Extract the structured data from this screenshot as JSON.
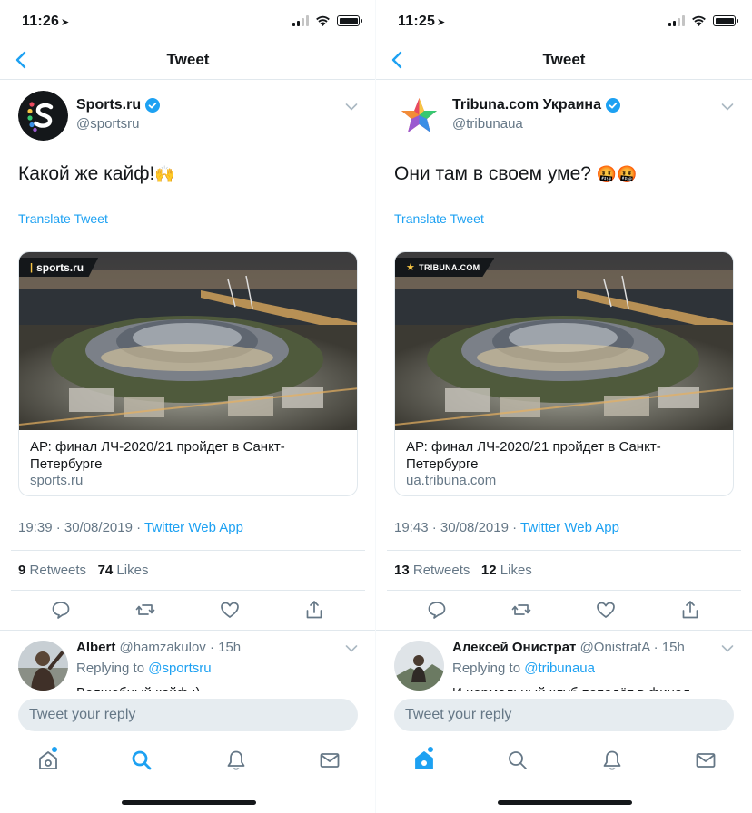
{
  "left": {
    "status": {
      "time": "11:26",
      "location_glyph": "➤"
    },
    "nav": {
      "title": "Tweet"
    },
    "tweet": {
      "display_name": "Sports.ru",
      "handle": "@sportsru",
      "text": "Какой же кайф!",
      "emoji": "🙌",
      "translate_label": "Translate Tweet",
      "card": {
        "badge": "sports.ru",
        "title": "АР: финал ЛЧ-2020/21 пройдет в Санкт-Петербурге",
        "domain": "sports.ru"
      },
      "timestamp": "19:39 · 30/08/2019 · ",
      "source_app": "Twitter Web App",
      "retweets_count": "9",
      "retweets_label": "Retweets",
      "likes_count": "74",
      "likes_label": "Likes"
    },
    "reply": {
      "name": "Albert",
      "handle_time": "@hamzakulov · 15h",
      "replying_to_label": "Replying to",
      "replying_to_handle": "@sportsru",
      "peek_text": "Волшебный кайф :)"
    },
    "compose_placeholder": "Tweet your reply"
  },
  "right": {
    "status": {
      "time": "11:25",
      "location_glyph": "➤"
    },
    "nav": {
      "title": "Tweet"
    },
    "tweet": {
      "display_name": "Tribuna.com Украина",
      "handle": "@tribunaua",
      "text": "Они там в своем уме?",
      "emoji": "🤬🤬",
      "translate_label": "Translate Tweet",
      "card": {
        "badge": "TRIBUNA.COM",
        "title": "АР: финал ЛЧ-2020/21 пройдет в Санкт-Петербурге",
        "domain": "ua.tribuna.com"
      },
      "timestamp": "19:43 · 30/08/2019 · ",
      "source_app": "Twitter Web App",
      "retweets_count": "13",
      "retweets_label": "Retweets",
      "likes_count": "12",
      "likes_label": "Likes"
    },
    "reply": {
      "name": "Алексей  Онистрат",
      "handle_time": "@OnistratA · 15h",
      "replying_to_label": "Replying to",
      "replying_to_handle": "@tribunaua",
      "peek_text": "И нормальный клуб попадёт в финал"
    },
    "compose_placeholder": "Tweet your reply"
  },
  "colors": {
    "accent": "#1da1f2",
    "text_primary": "#14171a",
    "text_secondary": "#657786",
    "divider": "#e1e8ed",
    "compose_bg": "#e6ecf0"
  },
  "icons": {
    "back": "chevron-left-icon",
    "verified": "verified-badge-icon",
    "reply": "comment-icon",
    "retweet": "retweet-icon",
    "like": "heart-icon",
    "share": "share-icon",
    "home": "home-icon",
    "search": "search-icon",
    "notifications": "bell-icon",
    "messages": "mail-icon"
  }
}
